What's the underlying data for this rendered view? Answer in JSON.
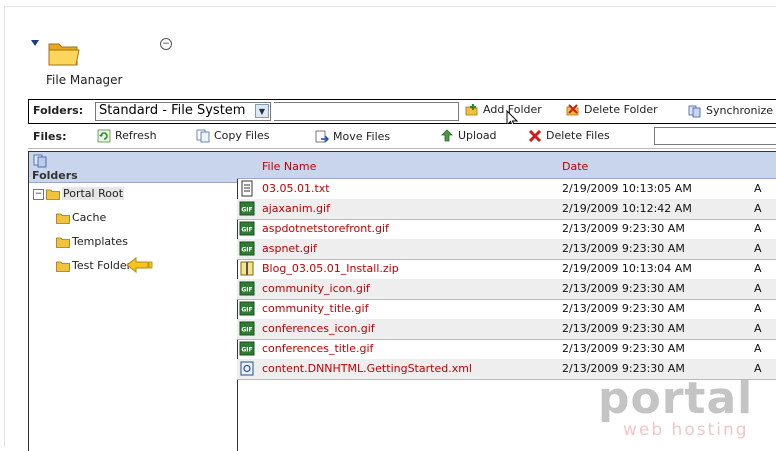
{
  "module": {
    "title": "File Manager"
  },
  "toolbar": {
    "folders_label": "Folders:",
    "folder_select_value": "Standard - File System",
    "add_folder": "Add Folder",
    "delete_folder": "Delete Folder",
    "synchronize": "Synchronize",
    "files_label": "Files:",
    "refresh": "Refresh",
    "copy_files": "Copy Files",
    "move_files": "Move Files",
    "upload": "Upload",
    "delete_files": "Delete Files"
  },
  "tree": {
    "header": "Folders",
    "root": "Portal Root",
    "children": [
      "Cache",
      "Templates",
      "Test Folder"
    ]
  },
  "grid": {
    "columns": {
      "name": "File Name",
      "date": "Date"
    },
    "rows": [
      {
        "name": "03.05.01.txt",
        "date": "2/19/2009 10:13:05 AM",
        "attr": "A",
        "type": "txt"
      },
      {
        "name": "ajaxanim.gif",
        "date": "2/19/2009 10:12:42 AM",
        "attr": "A",
        "type": "gif"
      },
      {
        "name": "aspdotnetstorefront.gif",
        "date": "2/13/2009 9:23:30 AM",
        "attr": "A",
        "type": "gif"
      },
      {
        "name": "aspnet.gif",
        "date": "2/13/2009 9:23:30 AM",
        "attr": "A",
        "type": "gif"
      },
      {
        "name": "Blog_03.05.01_Install.zip",
        "date": "2/19/2009 10:13:04 AM",
        "attr": "A",
        "type": "zip"
      },
      {
        "name": "community_icon.gif",
        "date": "2/13/2009 9:23:30 AM",
        "attr": "A",
        "type": "gif"
      },
      {
        "name": "community_title.gif",
        "date": "2/13/2009 9:23:30 AM",
        "attr": "A",
        "type": "gif"
      },
      {
        "name": "conferences_icon.gif",
        "date": "2/13/2009 9:23:30 AM",
        "attr": "A",
        "type": "gif"
      },
      {
        "name": "conferences_title.gif",
        "date": "2/13/2009 9:23:30 AM",
        "attr": "A",
        "type": "gif"
      },
      {
        "name": "content.DNNHTML.GettingStarted.xml",
        "date": "2/13/2009 9:23:30 AM",
        "attr": "A",
        "type": "xml"
      }
    ]
  },
  "watermark": {
    "main": "portal",
    "sub": "web hosting"
  },
  "colors": {
    "link_red": "#c00000",
    "header_blue": "#c9d5ec",
    "alt_row": "#eeeeee",
    "folder_yellow": "#f2c23a"
  }
}
